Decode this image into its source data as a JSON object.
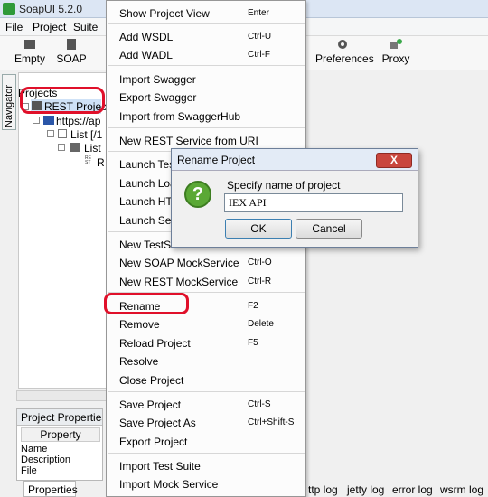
{
  "app": {
    "title": "SoapUI 5.2.0"
  },
  "menubar": [
    "File",
    "Project",
    "Suite"
  ],
  "toolbar": {
    "empty": "Empty",
    "soap": "SOAP",
    "preferences": "Preferences",
    "proxy": "Proxy"
  },
  "navigator": {
    "tab_label": "Navigator",
    "projects_label": "Projects",
    "tree": [
      {
        "label": "REST Project"
      },
      {
        "label": "https://ap"
      },
      {
        "label": "List [/1"
      },
      {
        "label": "List"
      },
      {
        "label": "R"
      }
    ]
  },
  "properties_panel": {
    "header": "Project Properties",
    "column": "Property",
    "rows": [
      "Name",
      "Description",
      "File"
    ],
    "tab": "Properties"
  },
  "log_tabs": [
    "ttp log",
    "jetty log",
    "error log",
    "wsrm log"
  ],
  "context_menu": {
    "items": [
      {
        "label": "Show Project View",
        "shortcut": "Enter"
      },
      {
        "label": "Add WSDL",
        "shortcut": "Ctrl-U"
      },
      {
        "label": "Add WADL",
        "shortcut": "Ctrl-F"
      },
      {
        "label": "Import Swagger",
        "shortcut": ""
      },
      {
        "label": "Export Swagger",
        "shortcut": ""
      },
      {
        "label": "Import from SwaggerHub",
        "shortcut": ""
      },
      {
        "label": "New REST Service from URI",
        "shortcut": ""
      },
      {
        "label": "Launch Test",
        "shortcut": ""
      },
      {
        "label": "Launch Load",
        "shortcut": ""
      },
      {
        "label": "Launch HTT",
        "shortcut": ""
      },
      {
        "label": "Launch Secu",
        "shortcut": ""
      },
      {
        "label": "New TestSu",
        "shortcut": ""
      },
      {
        "label": "New SOAP MockService",
        "shortcut": "Ctrl-O"
      },
      {
        "label": "New REST MockService",
        "shortcut": "Ctrl-R"
      },
      {
        "label": "Rename",
        "shortcut": "F2"
      },
      {
        "label": "Remove",
        "shortcut": "Delete"
      },
      {
        "label": "Reload Project",
        "shortcut": "F5"
      },
      {
        "label": "Resolve",
        "shortcut": ""
      },
      {
        "label": "Close Project",
        "shortcut": ""
      },
      {
        "label": "Save Project",
        "shortcut": "Ctrl-S"
      },
      {
        "label": "Save Project As",
        "shortcut": "Ctrl+Shift-S"
      },
      {
        "label": "Export Project",
        "shortcut": ""
      },
      {
        "label": "Import Test Suite",
        "shortcut": ""
      },
      {
        "label": "Import Mock Service",
        "shortcut": ""
      }
    ]
  },
  "dialog": {
    "title": "Rename Project",
    "close_label": "X",
    "prompt": "Specify name of project",
    "value": "IEX API",
    "ok_label": "OK",
    "cancel_label": "Cancel"
  }
}
